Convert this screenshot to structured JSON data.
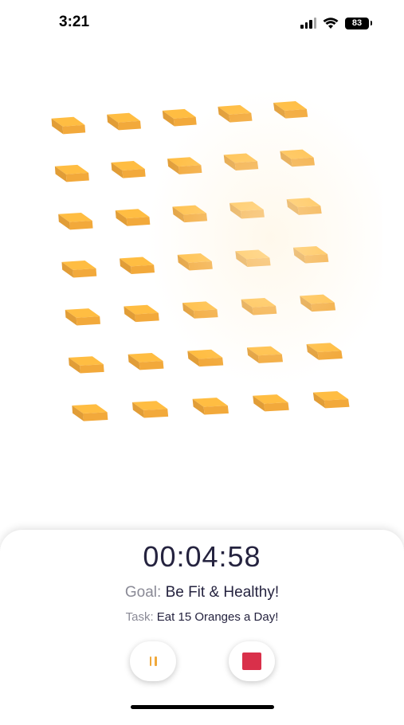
{
  "status_bar": {
    "time": "3:21",
    "battery": "83"
  },
  "session": {
    "elapsed": "00:04:58",
    "goal_label": "Goal:",
    "goal_value": "Be Fit & Healthy!",
    "task_label": "Task:",
    "task_value": "Eat 15 Oranges a Day!"
  },
  "controls": {
    "pause_icon": "pause-icon",
    "stop_icon": "stop-icon"
  },
  "colors": {
    "cube": "#f2a93b",
    "accent": "#f0a83a",
    "stop": "#d9304a",
    "text": "#25233f",
    "muted": "#8a8a96"
  }
}
